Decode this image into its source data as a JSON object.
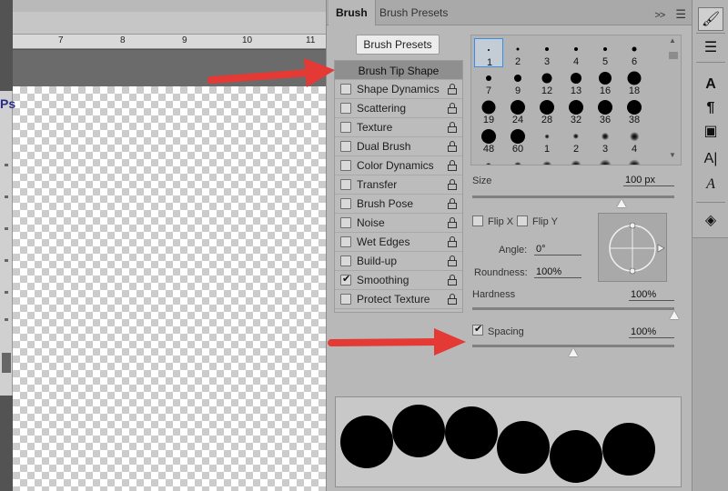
{
  "ruler": {
    "numbers": [
      "7",
      "8",
      "9",
      "10",
      "11"
    ]
  },
  "app_logo": "Ps",
  "tabs": {
    "brush": "Brush",
    "brush_presets": "Brush Presets",
    "expand": ">>"
  },
  "brush_presets_button": "Brush Presets",
  "settings": {
    "header": "Brush Tip Shape",
    "items": [
      {
        "label": "Shape Dynamics",
        "checked": false
      },
      {
        "label": "Scattering",
        "checked": false
      },
      {
        "label": "Texture",
        "checked": false
      },
      {
        "label": "Dual Brush",
        "checked": false
      },
      {
        "label": "Color Dynamics",
        "checked": false
      },
      {
        "label": "Transfer",
        "checked": false
      },
      {
        "label": "Brush Pose",
        "checked": false
      },
      {
        "label": "Noise",
        "checked": false
      },
      {
        "label": "Wet Edges",
        "checked": false
      },
      {
        "label": "Build-up",
        "checked": false
      },
      {
        "label": "Smoothing",
        "checked": true
      },
      {
        "label": "Protect Texture",
        "checked": false
      }
    ]
  },
  "tips": [
    {
      "label": "1",
      "selected": true
    },
    {
      "label": "2"
    },
    {
      "label": "3"
    },
    {
      "label": "4"
    },
    {
      "label": "5"
    },
    {
      "label": "6"
    },
    {
      "label": "7"
    },
    {
      "label": "9"
    },
    {
      "label": "12"
    },
    {
      "label": "13"
    },
    {
      "label": "16"
    },
    {
      "label": "18"
    },
    {
      "label": "19"
    },
    {
      "label": "24"
    },
    {
      "label": "28"
    },
    {
      "label": "32"
    },
    {
      "label": "36"
    },
    {
      "label": "38"
    },
    {
      "label": "48"
    },
    {
      "label": "60"
    },
    {
      "label": "1"
    },
    {
      "label": "2"
    },
    {
      "label": "3"
    },
    {
      "label": "4"
    },
    {
      "label": ""
    },
    {
      "label": ""
    },
    {
      "label": ""
    },
    {
      "label": ""
    },
    {
      "label": ""
    },
    {
      "label": ""
    }
  ],
  "size": {
    "label": "Size",
    "value": "100 px",
    "level": 0.74
  },
  "flip_x": {
    "label": "Flip X",
    "checked": false
  },
  "flip_y": {
    "label": "Flip Y",
    "checked": false
  },
  "angle": {
    "label": "Angle:",
    "value": "0°"
  },
  "roundness": {
    "label": "Roundness:",
    "value": "100%"
  },
  "hardness": {
    "label": "Hardness",
    "value": "100%",
    "level": 1.0
  },
  "spacing": {
    "label": "Spacing",
    "value": "100%",
    "checked": true,
    "level": 0.5
  },
  "colors": {
    "panel": "#b8b8b8",
    "arrow": "#e53935",
    "selection": "#3a8ee6"
  }
}
